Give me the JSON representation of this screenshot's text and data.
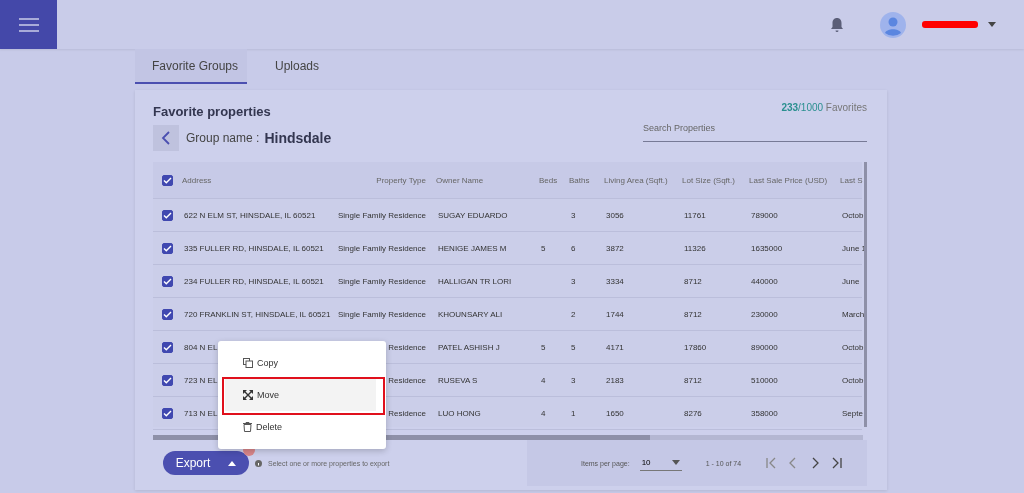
{
  "header": {
    "user_name_redacted": true
  },
  "tabs": [
    {
      "label": "Favorite Groups",
      "selected": true
    },
    {
      "label": "Uploads",
      "selected": false
    }
  ],
  "card": {
    "title": "Favorite properties",
    "count_used": "233",
    "count_total": "/1000",
    "count_label": "Favorites",
    "group_label": "Group name :",
    "group_name": "Hindsdale",
    "search": {
      "placeholder": "Search Properties"
    }
  },
  "table": {
    "all_checked": true,
    "columns": [
      "Address",
      "Property Type",
      "Owner Name",
      "Beds",
      "Baths",
      "Living Area (Sqft.)",
      "Lot Size (Sqft.)",
      "Last Sale Price (USD)",
      "Last S"
    ],
    "rows": [
      {
        "checked": true,
        "cells": [
          "622 N ELM ST, HINSDALE, IL 60521",
          "Single Family Residence",
          "SUGAY EDUARDO",
          "",
          "3",
          "3056",
          "11761",
          "789000",
          "Octob"
        ]
      },
      {
        "checked": true,
        "cells": [
          "335 FULLER RD, HINSDALE, IL 60521",
          "Single Family Residence",
          "HENIGE JAMES M",
          "5",
          "6",
          "3872",
          "11326",
          "1635000",
          "June 1"
        ]
      },
      {
        "checked": true,
        "cells": [
          "234 FULLER RD, HINSDALE, IL 60521",
          "Single Family Residence",
          "HALLIGAN TR LORI",
          "",
          "3",
          "3334",
          "8712",
          "440000",
          "June"
        ]
      },
      {
        "checked": true,
        "cells": [
          "720 FRANKLIN ST, HINSDALE, IL 60521",
          "Single Family Residence",
          "KHOUNSARY ALI",
          "",
          "2",
          "1744",
          "8712",
          "230000",
          "March"
        ]
      },
      {
        "checked": true,
        "cells": [
          "804 N EL",
          "Residence",
          "PATEL ASHISH J",
          "5",
          "5",
          "4171",
          "17860",
          "890000",
          "Octob"
        ]
      },
      {
        "checked": true,
        "cells": [
          "723 N EL",
          "Residence",
          "RUSEVA S",
          "4",
          "3",
          "2183",
          "8712",
          "510000",
          "Octob"
        ]
      },
      {
        "checked": true,
        "cells": [
          "713 N EL",
          "Residence",
          "LUO HONG",
          "4",
          "1",
          "1650",
          "8276",
          "358000",
          "Septe"
        ]
      }
    ]
  },
  "footer": {
    "export_label": "Export",
    "hint": "Select one or more properties to export",
    "items_per_page_label": "Items per page:",
    "items_per_page": "10",
    "range": "1 - 10 of 74"
  },
  "menu": {
    "items": [
      {
        "label": "Copy",
        "kind": "copy",
        "selected": false
      },
      {
        "label": "Move",
        "kind": "move",
        "selected": true
      },
      {
        "label": "Delete",
        "kind": "delete",
        "selected": false
      }
    ]
  }
}
